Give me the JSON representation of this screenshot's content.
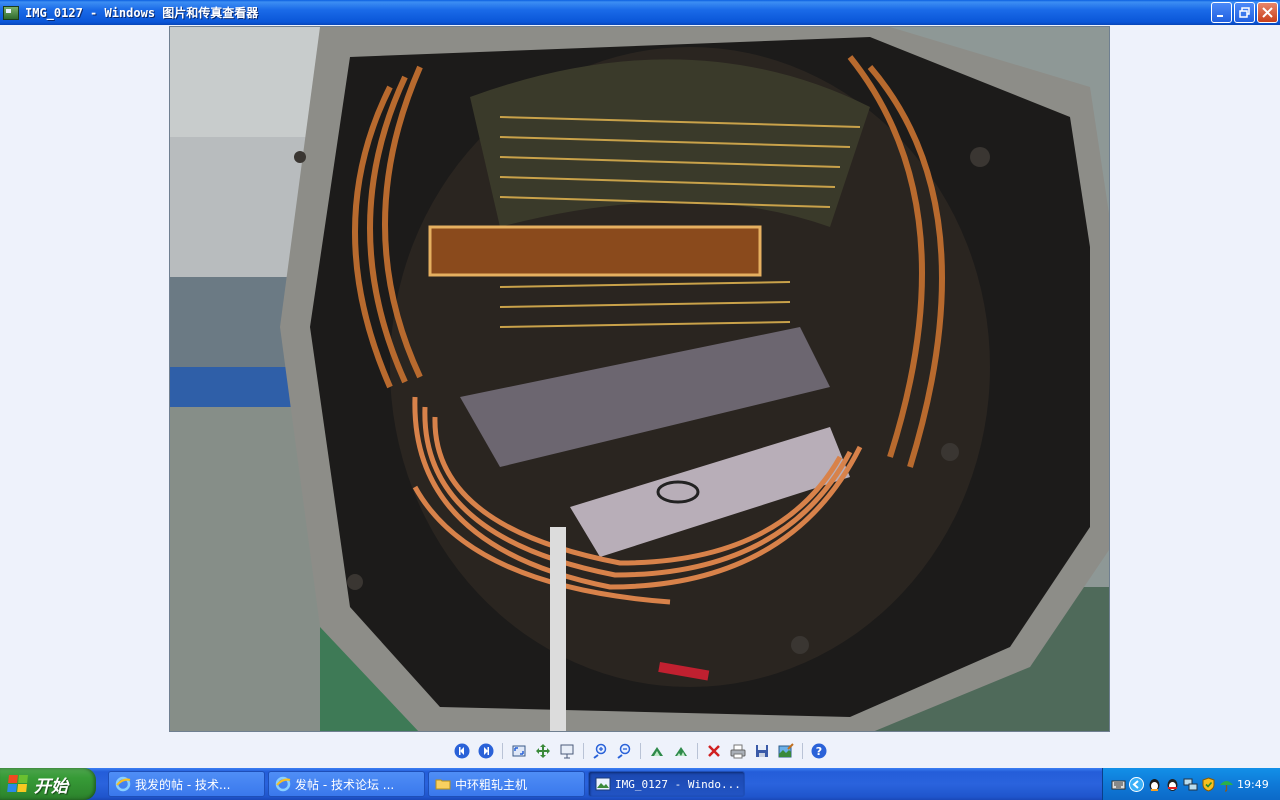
{
  "window": {
    "title": "IMG_0127 - Windows 图片和传真查看器",
    "minimize_icon": "minimize-icon",
    "restore_icon": "restore-icon",
    "close_icon": "close-icon"
  },
  "viewer": {
    "image_subject": "photo of an open electric motor stator with copper windings",
    "toolbar": [
      {
        "name": "previous-image-button",
        "icon": "previous-icon"
      },
      {
        "name": "next-image-button",
        "icon": "next-icon"
      },
      {
        "name": "best-fit-button",
        "icon": "best-fit-icon"
      },
      {
        "name": "actual-size-button",
        "icon": "actual-size-icon"
      },
      {
        "name": "slideshow-button",
        "icon": "slideshow-icon"
      },
      {
        "name": "zoom-in-button",
        "icon": "zoom-in-icon"
      },
      {
        "name": "zoom-out-button",
        "icon": "zoom-out-icon"
      },
      {
        "name": "rotate-clockwise-button",
        "icon": "rotate-clockwise-icon"
      },
      {
        "name": "rotate-counterclockwise-button",
        "icon": "rotate-counterclockwise-icon"
      },
      {
        "name": "delete-button",
        "icon": "delete-icon"
      },
      {
        "name": "print-button",
        "icon": "print-icon"
      },
      {
        "name": "save-button",
        "icon": "save-icon"
      },
      {
        "name": "edit-button",
        "icon": "edit-icon"
      },
      {
        "name": "help-button",
        "icon": "help-icon"
      }
    ]
  },
  "taskbar": {
    "start_label": "开始",
    "tasks": [
      {
        "label": "我发的帖 - 技术...",
        "icon": "internet-explorer-icon",
        "active": false
      },
      {
        "label": "发帖 - 技术论坛 ...",
        "icon": "internet-explorer-icon",
        "active": false
      },
      {
        "label": "中环粗轧主机",
        "icon": "folder-icon",
        "active": false
      },
      {
        "label": "IMG_0127 - Windo...",
        "icon": "image-viewer-icon",
        "active": true
      }
    ],
    "tray": {
      "icons": [
        "keyboard-icon",
        "show-hidden-icons-icon",
        "qq-penguin-icon",
        "qq-icon",
        "network-icon",
        "security-shield-icon",
        "umbrella-icon"
      ],
      "clock": "19:49"
    }
  },
  "colors": {
    "titlebar": "#0a56d8",
    "taskbar": "#245dd9",
    "start": "#379b37",
    "viewer_bg": "#eef2fb"
  }
}
